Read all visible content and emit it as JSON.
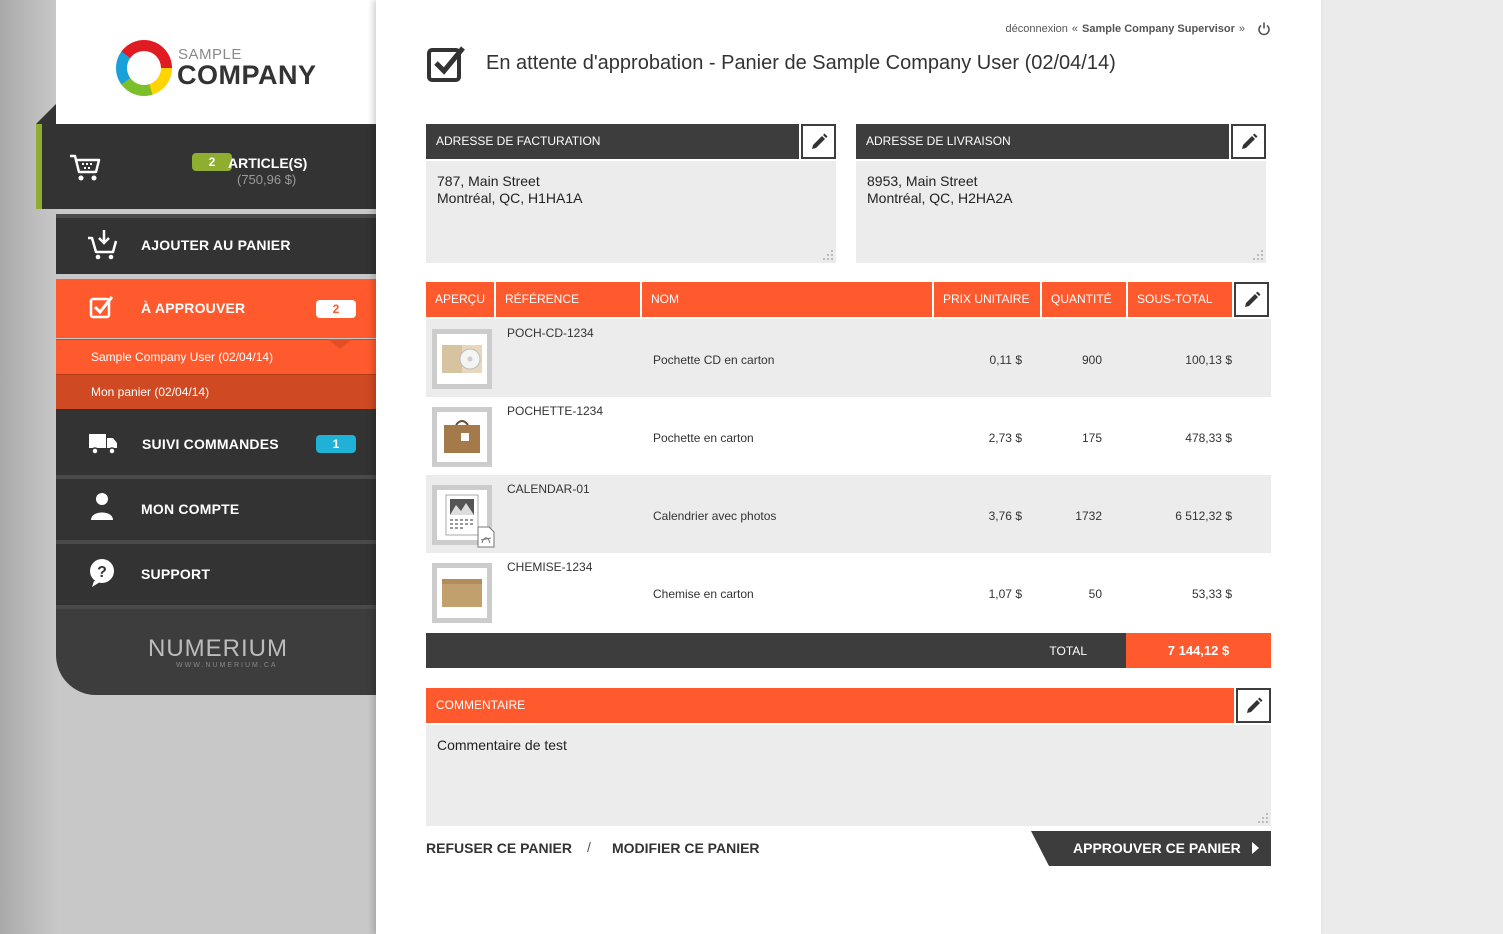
{
  "colors": {
    "accent": "#ff5a2e",
    "dark": "#333333",
    "cart_badge": "#8fae2f",
    "orders_badge": "#1fb2d6",
    "panel_bg": "#ececec"
  },
  "logo": {
    "top": "SAMPLE",
    "bottom": "COMPANY"
  },
  "sidebar": {
    "cart": {
      "count": "2",
      "label": "ARTICLE(S)",
      "total": "(750,96 $)",
      "icon": "cart-icon"
    },
    "nav": {
      "add_to_cart": {
        "label": "AJOUTER AU PANIER",
        "icon": "add-to-cart-icon"
      },
      "approve": {
        "label": "À APPROUVER",
        "badge": "2",
        "icon": "checkbox-icon"
      },
      "approve_subitems": [
        {
          "label": "Sample Company User (02/04/14)"
        },
        {
          "label": "Mon panier (02/04/14)"
        }
      ],
      "orders": {
        "label": "SUIVI COMMANDES",
        "badge": "1",
        "icon": "truck-icon"
      },
      "account": {
        "label": "MON COMPTE",
        "icon": "user-icon"
      },
      "support": {
        "label": "SUPPORT",
        "icon": "help-icon"
      }
    },
    "footer": {
      "brand": "NUMERIUM",
      "url": "WWW.NUMERIUM.CA"
    }
  },
  "topbar": {
    "logout_label": "déconnexion",
    "user_prefix": "«",
    "user": "Sample Company Supervisor",
    "user_suffix": "»",
    "icon": "power-icon"
  },
  "page": {
    "title": "En attente d'approbation - Panier de Sample Company User (02/04/14)"
  },
  "billing": {
    "heading": "ADRESSE DE FACTURATION",
    "line1": "787, Main Street",
    "line2": "Montréal, QC, H1HA1A"
  },
  "shipping": {
    "heading": "ADRESSE DE LIVRAISON",
    "line1": "8953, Main Street",
    "line2": "Montréal, QC, H2HA2A"
  },
  "table": {
    "headers": [
      "APERÇU",
      "RÉFÉRENCE",
      "NOM",
      "PRIX UNITAIRE",
      "QUANTITÉ",
      "SOUS-TOTAL"
    ],
    "rows": [
      {
        "ref": "POCH-CD-1234",
        "name": "Pochette CD en carton",
        "price": "0,11 $",
        "qty": "900",
        "subtotal": "100,13 $",
        "thumb": "cd-sleeve-image"
      },
      {
        "ref": "POCHETTE-1234",
        "name": "Pochette en carton",
        "price": "2,73 $",
        "qty": "175",
        "subtotal": "478,33 $",
        "thumb": "folder-bag-image"
      },
      {
        "ref": "CALENDAR-01",
        "name": "Calendrier avec photos",
        "price": "3,76 $",
        "qty": "1732",
        "subtotal": "6 512,32 $",
        "thumb": "calendar-image"
      },
      {
        "ref": "CHEMISE-1234",
        "name": "Chemise en carton",
        "price": "1,07 $",
        "qty": "50",
        "subtotal": "53,33 $",
        "thumb": "cardboard-folder-image"
      }
    ],
    "total_label": "TOTAL",
    "total_value": "7 144,12 $"
  },
  "comment": {
    "heading": "COMMENTAIRE",
    "text": "Commentaire de test"
  },
  "actions": {
    "refuse": "REFUSER CE PANIER",
    "separator": "/",
    "modify": "MODIFIER CE PANIER",
    "approve": "APPROUVER CE PANIER"
  }
}
